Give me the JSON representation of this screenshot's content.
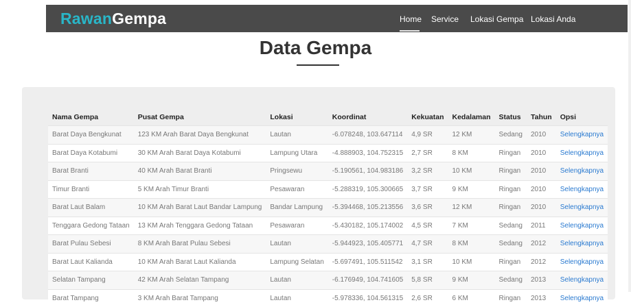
{
  "brand": {
    "part1": "Rawan",
    "part2": "Gempa"
  },
  "nav": {
    "home": "Home",
    "service": "Service",
    "lokasi_gempa": "Lokasi Gempa",
    "lokasi_anda": "Lokasi Anda"
  },
  "page": {
    "title": "Data Gempa"
  },
  "table": {
    "headers": [
      "Nama Gempa",
      "Pusat Gempa",
      "Lokasi",
      "Koordinat",
      "Kekuatan",
      "Kedalaman",
      "Status",
      "Tahun",
      "Opsi"
    ],
    "rows": [
      [
        "Barat Daya Bengkunat",
        "123 KM Arah Barat Daya Bengkunat",
        "Lautan",
        "-6.078248, 103.647114",
        "4,9 SR",
        "12 KM",
        "Sedang",
        "2010",
        "Selengkapnya"
      ],
      [
        "Barat Daya Kotabumi",
        "30 KM Arah Barat Daya Kotabumi",
        "Lampung Utara",
        "-4.888903, 104.752315",
        "2,7 SR",
        "8 KM",
        "Ringan",
        "2010",
        "Selengkapnya"
      ],
      [
        "Barat Branti",
        "40 KM Arah Barat Branti",
        "Pringsewu",
        "-5.190561, 104.983186",
        "3,2 SR",
        "10 KM",
        "Ringan",
        "2010",
        "Selengkapnya"
      ],
      [
        "Timur Branti",
        "5 KM Arah Timur Branti",
        "Pesawaran",
        "-5.288319, 105.300665",
        "3,7 SR",
        "9 KM",
        "Ringan",
        "2010",
        "Selengkapnya"
      ],
      [
        "Barat Laut Balam",
        "10 KM Arah Barat Laut Bandar Lampung",
        "Bandar Lampung",
        "-5.394468, 105.213556",
        "3,6 SR",
        "12 KM",
        "Ringan",
        "2010",
        "Selengkapnya"
      ],
      [
        "Tenggara Gedong Tataan",
        "13 KM Arah Tenggara Gedong Tataan",
        "Pesawaran",
        "-5.430182, 105.174002",
        "4,5 SR",
        "7 KM",
        "Sedang",
        "2011",
        "Selengkapnya"
      ],
      [
        "Barat Pulau Sebesi",
        "8 KM Arah Barat Pulau Sebesi",
        "Lautan",
        "-5.944923, 105.405771",
        "4,7 SR",
        "8 KM",
        "Sedang",
        "2012",
        "Selengkapnya"
      ],
      [
        "Barat Laut Kalianda",
        "10 KM Arah Barat Laut Kalianda",
        "Lampung Selatan",
        "-5.697491, 105.511542",
        "3,1 SR",
        "10 KM",
        "Ringan",
        "2012",
        "Selengkapnya"
      ],
      [
        "Selatan Tampang",
        "42 KM Arah Selatan Tampang",
        "Lautan",
        "-6.176949, 104.741605",
        "5,8 SR",
        "9 KM",
        "Sedang",
        "2013",
        "Selengkapnya"
      ],
      [
        "Barat Tampang",
        "3 KM Arah Barat Tampang",
        "Lautan",
        "-5.978336, 104.561315",
        "2,6 SR",
        "6 KM",
        "Ringan",
        "2013",
        "Selengkapnya"
      ]
    ]
  },
  "colors": {
    "brand_accent": "#29b6c8",
    "navbar_bg": "#4a4a4a",
    "link": "#2a7ad0",
    "panel_bg": "#eeeeee"
  }
}
